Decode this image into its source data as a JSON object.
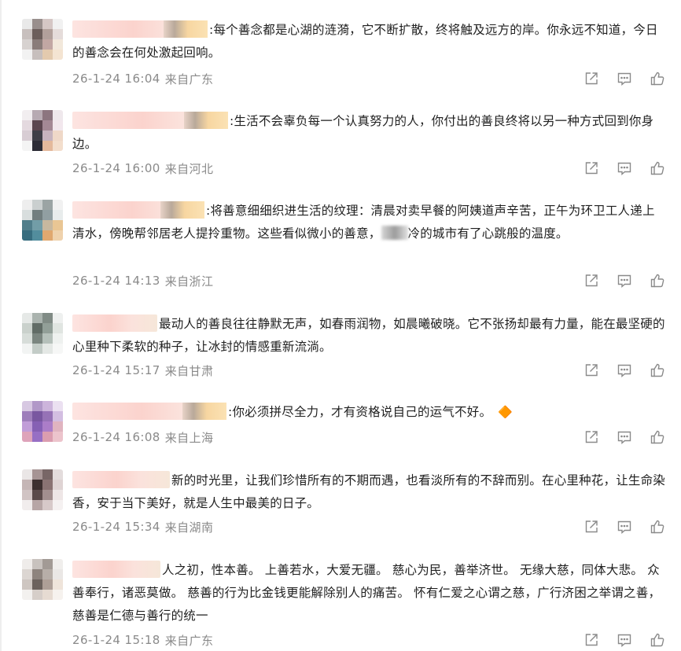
{
  "comments": [
    {
      "text": "每个善念都是心湖的涟漪，它不断扩散，终将触及远方的岸。你永远不知道，今日的善念会在何处激起回响。",
      "time": "26-1-24 16:04",
      "location": "来自广东",
      "avatar_colors": [
        "#e9e9e9",
        "#9a8f8c",
        "#d7c7c4",
        "#f1f1f1",
        "#c9c0bd",
        "#6e5d5a",
        "#b59f9a",
        "#e6dcd9",
        "#d8d2cf",
        "#8c7b78",
        "#c6a6a1",
        "#f3e8d8",
        "#f2f2f2",
        "#c8bfbc",
        "#e7c9a8",
        "#f6e4cf"
      ]
    },
    {
      "text": "生活不会辜负每一个认真努力的人，你付出的善良终将以另一种方式回到你身边。",
      "time": "26-1-24 16:00",
      "location": "来自河北",
      "avatar_colors": [
        "#f3eef0",
        "#b9a9b3",
        "#8f7480",
        "#f0e8ec",
        "#e6d8e0",
        "#5e4450",
        "#a88796",
        "#f4e6ee",
        "#d9cdd5",
        "#3e3e48",
        "#c8b2bf",
        "#f2d7c4",
        "#f4f4f4",
        "#2c2c38",
        "#eab896",
        "#f6ddc9"
      ]
    },
    {
      "text": "将善意细细织进生活的纹理：清晨对卖早餐的阿姨道声辛苦，正午为环卫工人递上清水，傍晚帮邻居老人提拎重物。这些看似微小的善意，",
      "text_tail": "冷的城市有了心跳般的温度。",
      "time": "26-1-24 14:13",
      "location": "来自浙江",
      "avatar_colors": [
        "#eeeeee",
        "#c9cfcf",
        "#9aa4a4",
        "#f1f1f1",
        "#d7dede",
        "#6f7e80",
        "#8fa0a3",
        "#e8ecec",
        "#4b7f8f",
        "#6c9faa",
        "#c9b89a",
        "#efc58a",
        "#2f6f84",
        "#4a8fa2",
        "#e9a764",
        "#f3d1a6"
      ]
    },
    {
      "text": "最动人的善良往往静默无声，如春雨润物，如晨曦破晓。它不张扬却最有力量，能在最坚硬的心里种下柔软的种子，让冰封的情感重新流淌。",
      "time": "26-1-24 15:17",
      "location": "来自甘肃",
      "avatar_colors": [
        "#e6e9e7",
        "#a9b3ad",
        "#7f8c84",
        "#eef0ef",
        "#c9d1cc",
        "#5f6d65",
        "#90a097",
        "#dfe5e1",
        "#d6ddd9",
        "#7a877f",
        "#b4c0b9",
        "#eef1ef",
        "#f2f4f3",
        "#c2ccc6",
        "#e3e8e5",
        "#f6f7f6"
      ]
    },
    {
      "text": "你必须拼尽全力，才有资格说自己的运气不好。",
      "emoji": "🔶",
      "time": "26-1-24 16:08",
      "location": "来自上海",
      "avatar_colors": [
        "#d9c7e6",
        "#b496cf",
        "#cfb3e0",
        "#ecdff3",
        "#a27cc4",
        "#7d55ab",
        "#9a70c0",
        "#d5bde6",
        "#c59be0",
        "#8a5ec0",
        "#b17ad3",
        "#e6b2c0",
        "#e6a0bc",
        "#9c6cd0",
        "#e39ab0",
        "#f2c2cc"
      ]
    },
    {
      "text": "新的时光里，让我们珍惜所有的不期而遇，也看淡所有的不辞而别。在心里种花，让生命染香，安于当下美好，就是人生中最美的日子。",
      "time": "26-1-24 15:34",
      "location": "来自湖南",
      "avatar_colors": [
        "#ebe6e6",
        "#a89393",
        "#7b6565",
        "#e4dcdc",
        "#c7b5b5",
        "#3f2f2f",
        "#8d7272",
        "#e1d4d4",
        "#d3c4c4",
        "#5c4848",
        "#a58d8d",
        "#efe6e6",
        "#f2eded",
        "#b9a5a5",
        "#d9c8c8",
        "#f6f1f1"
      ]
    },
    {
      "text": "人之初，性本善。 上善若水，大爱无疆。 慈心为民，善举济世。 无缘大慈，同体大悲。 众善奉行，诸恶莫做。 慈善的行为比金钱更能解除别人的痛苦。 怀有仁爱之心谓之慈，广行济困之举谓之善，慈善是仁德与善行的统一",
      "time": "26-1-24 15:18",
      "location": "来自广东",
      "avatar_colors": [
        "#efecea",
        "#c9c2bd",
        "#a39a94",
        "#f0eeec",
        "#ddd6d1",
        "#8f847d",
        "#b8aea7",
        "#ebe7e4",
        "#cfc6c0",
        "#6d625c",
        "#b09f95",
        "#f1e4d8",
        "#f3f1ef",
        "#d7cec8",
        "#e8dbd0",
        "#f7f2ed"
      ]
    }
  ],
  "actions": [
    "share-icon",
    "comment-icon",
    "like-icon"
  ]
}
